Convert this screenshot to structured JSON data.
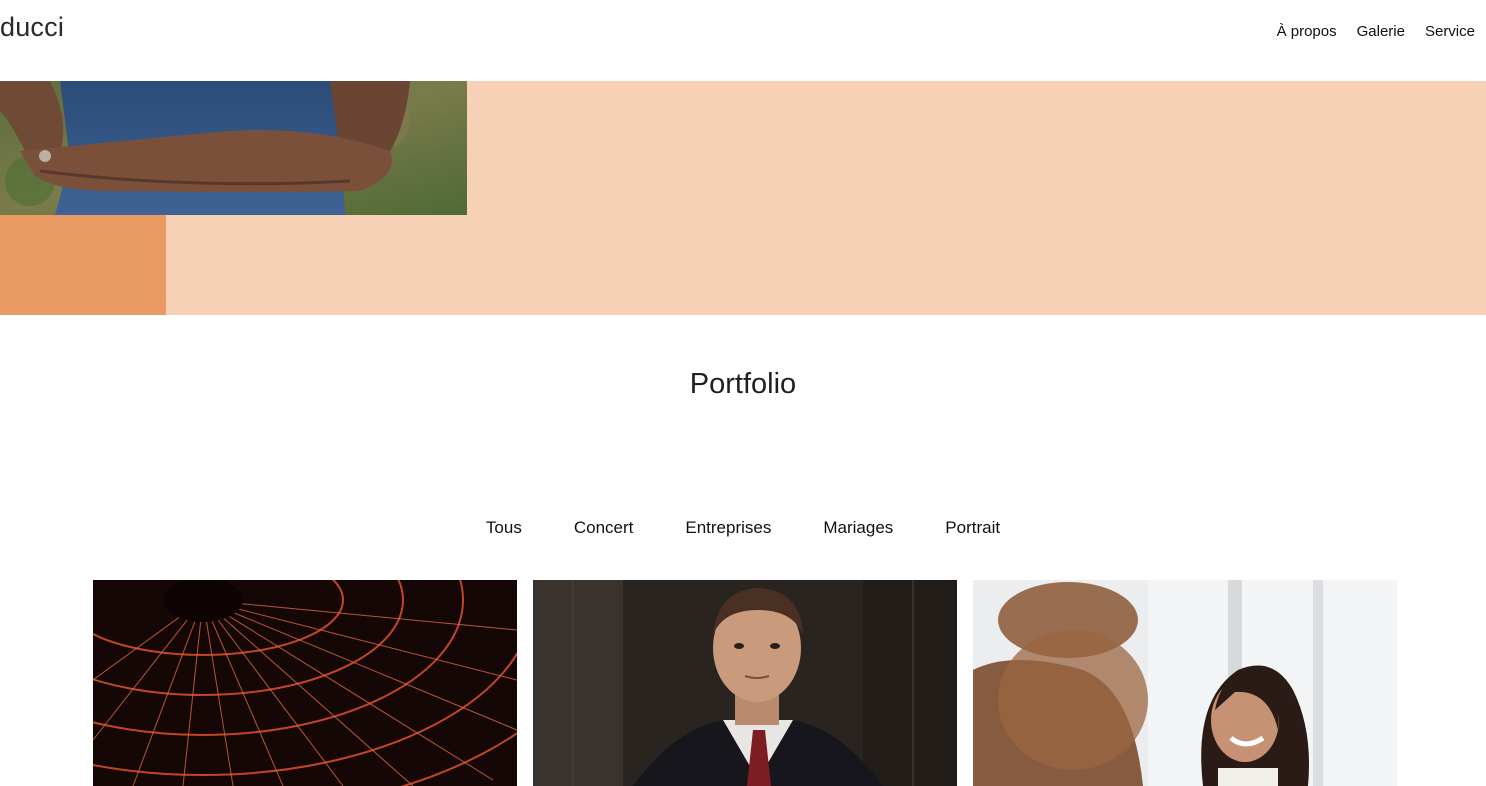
{
  "brand": {
    "logo_text": "ducci"
  },
  "nav": {
    "items": [
      {
        "label": "À propos"
      },
      {
        "label": "Galerie"
      },
      {
        "label": "Service"
      }
    ]
  },
  "hero": {
    "background_color": "#f6d1b6",
    "accent_color": "#e89a62"
  },
  "portfolio": {
    "title": "Portfolio",
    "filters": [
      {
        "label": "Tous"
      },
      {
        "label": "Concert"
      },
      {
        "label": "Entreprises"
      },
      {
        "label": "Mariages"
      },
      {
        "label": "Portrait"
      }
    ],
    "cards": [
      {
        "subject": "concert-stage-lights"
      },
      {
        "subject": "businessman-portrait"
      },
      {
        "subject": "smiling-woman-office"
      }
    ]
  }
}
